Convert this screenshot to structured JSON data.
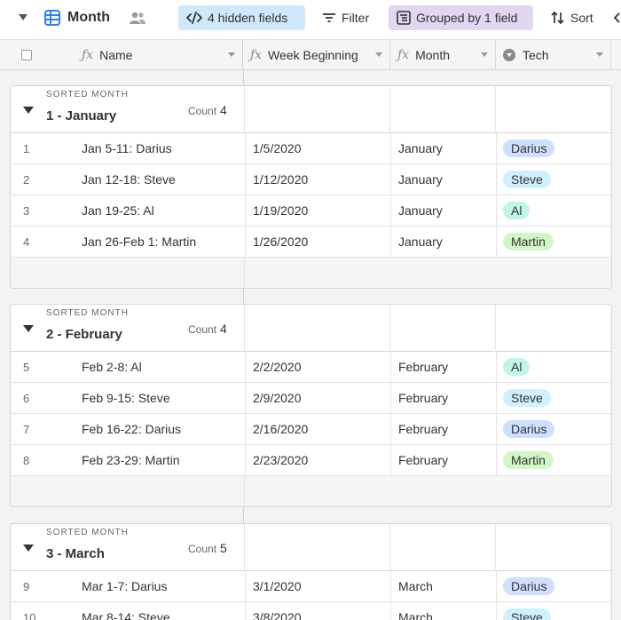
{
  "toolbar": {
    "view_name": "Month",
    "hidden_fields": "4 hidden fields",
    "filter": "Filter",
    "grouped": "Grouped by 1 field",
    "sort": "Sort"
  },
  "columns": {
    "name": "Name",
    "week": "Week Beginning",
    "month": "Month",
    "tech": "Tech"
  },
  "groups": [
    {
      "label": "SORTED MONTH",
      "title": "1 - January",
      "count_label": "Count",
      "count": "4",
      "rows": [
        {
          "num": "1",
          "name": "Jan 5-11: Darius",
          "week": "1/5/2020",
          "month": "January",
          "tech": "Darius"
        },
        {
          "num": "2",
          "name": "Jan 12-18: Steve",
          "week": "1/12/2020",
          "month": "January",
          "tech": "Steve"
        },
        {
          "num": "3",
          "name": "Jan 19-25: Al",
          "week": "1/19/2020",
          "month": "January",
          "tech": "Al"
        },
        {
          "num": "4",
          "name": "Jan 26-Feb 1: Martin",
          "week": "1/26/2020",
          "month": "January",
          "tech": "Martin"
        }
      ]
    },
    {
      "label": "SORTED MONTH",
      "title": "2 - February",
      "count_label": "Count",
      "count": "4",
      "rows": [
        {
          "num": "5",
          "name": "Feb 2-8: Al",
          "week": "2/2/2020",
          "month": "February",
          "tech": "Al"
        },
        {
          "num": "6",
          "name": "Feb 9-15: Steve",
          "week": "2/9/2020",
          "month": "February",
          "tech": "Steve"
        },
        {
          "num": "7",
          "name": "Feb 16-22: Darius",
          "week": "2/16/2020",
          "month": "February",
          "tech": "Darius"
        },
        {
          "num": "8",
          "name": "Feb 23-29: Martin",
          "week": "2/23/2020",
          "month": "February",
          "tech": "Martin"
        }
      ]
    },
    {
      "label": "SORTED MONTH",
      "title": "3 - March",
      "count_label": "Count",
      "count": "5",
      "rows": [
        {
          "num": "9",
          "name": "Mar 1-7: Darius",
          "week": "3/1/2020",
          "month": "March",
          "tech": "Darius"
        },
        {
          "num": "10",
          "name": "Mar 8-14: Steve",
          "week": "3/8/2020",
          "month": "March",
          "tech": "Steve"
        }
      ]
    }
  ],
  "tech_colors": {
    "Darius": "#cfdfff",
    "Steve": "#d0f0fd",
    "Al": "#c2f5e9",
    "Martin": "#d1f7c4"
  }
}
